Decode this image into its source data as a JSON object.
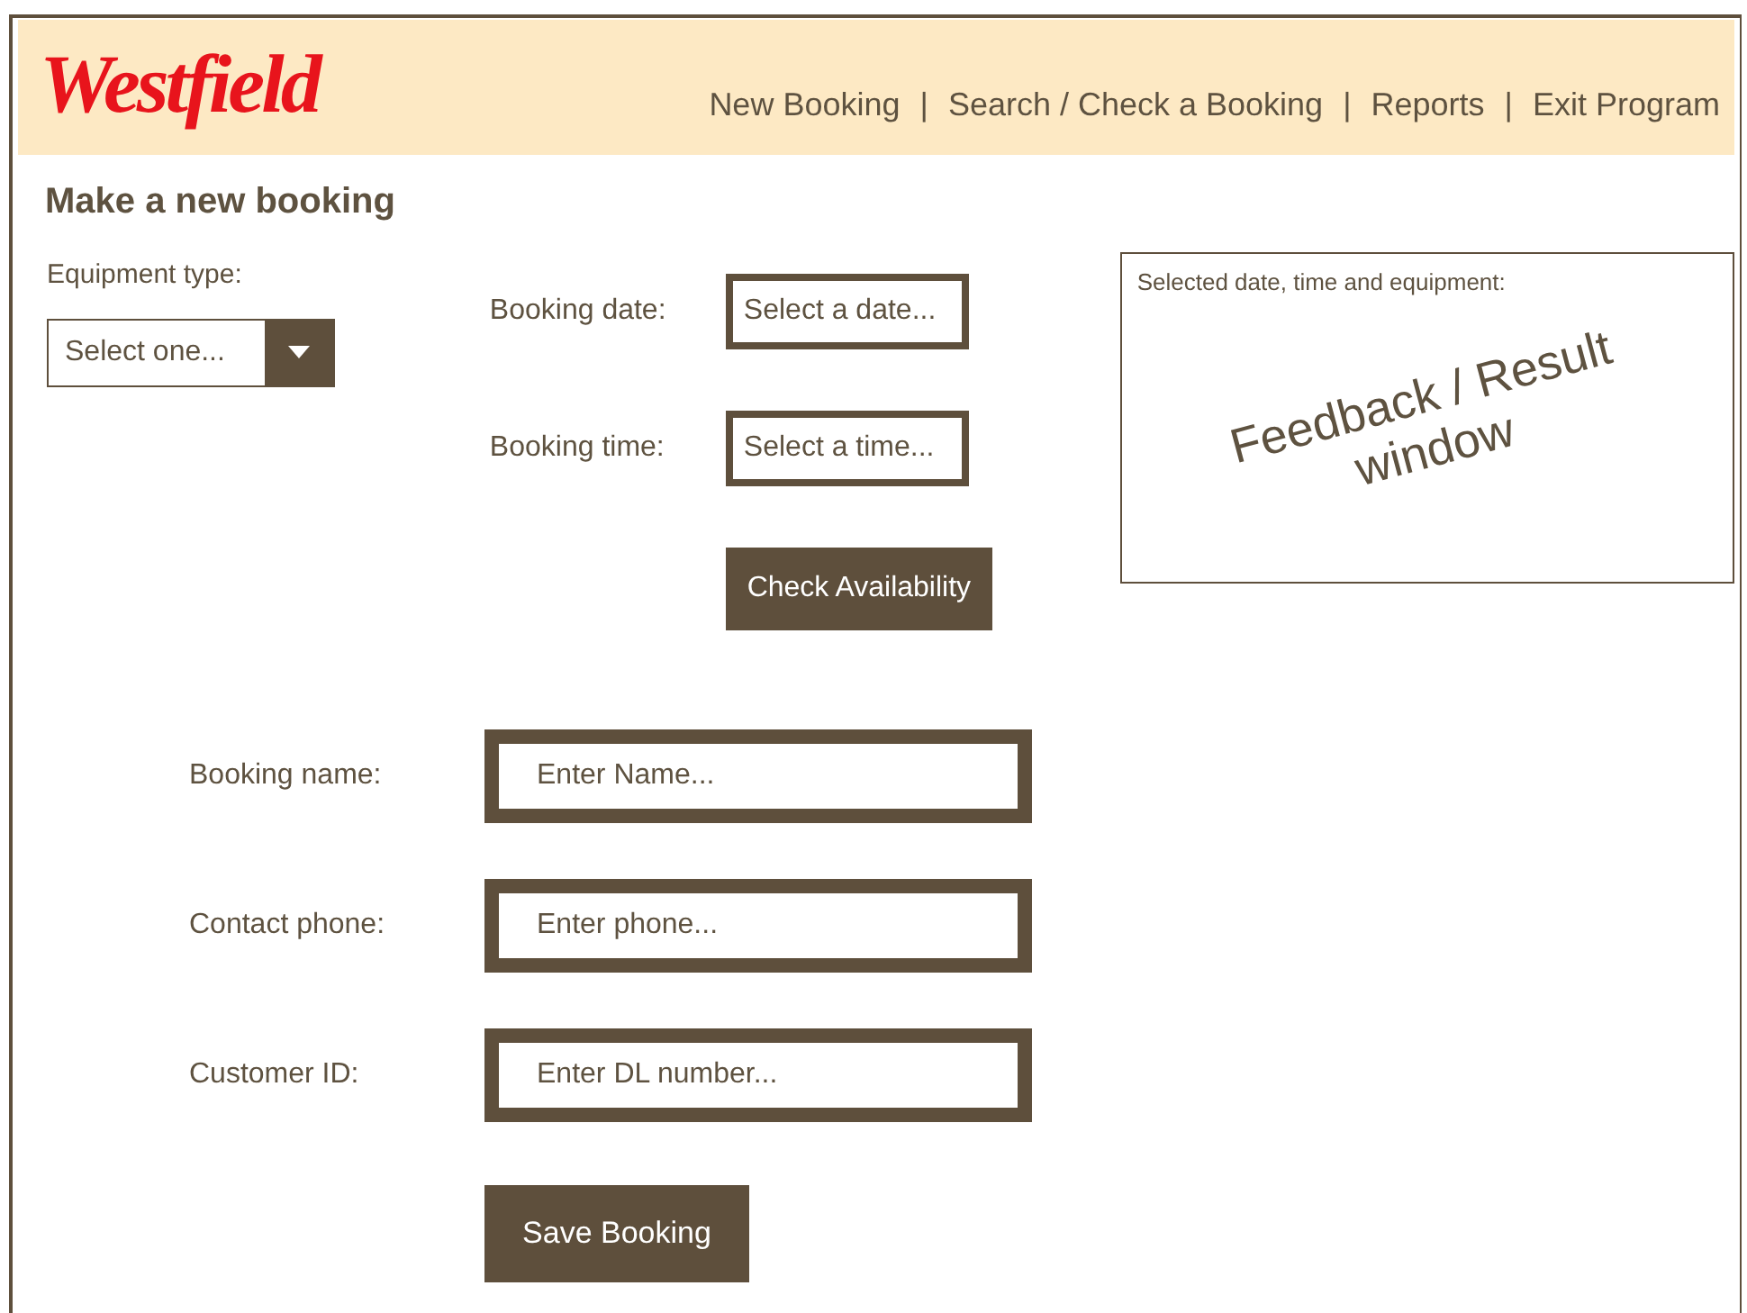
{
  "header": {
    "logo": "Westfield",
    "nav": [
      {
        "label": "New Booking"
      },
      {
        "label": "Search / Check a Booking"
      },
      {
        "label": "Reports"
      },
      {
        "label": "Exit Program"
      }
    ],
    "separator": "|"
  },
  "title": "Make a new booking",
  "equipment": {
    "label": "Equipment type:",
    "placeholder": "Select one..."
  },
  "date": {
    "label": "Booking date:",
    "placeholder": "Select a date..."
  },
  "time": {
    "label": "Booking time:",
    "placeholder": "Select a time..."
  },
  "check_button": "Check Availability",
  "feedback": {
    "heading": "Selected date, time and equipment:",
    "lines": [
      "Feedback / Result",
      "window"
    ]
  },
  "fields": [
    {
      "label": "Booking name:",
      "placeholder": "Enter Name..."
    },
    {
      "label": "Contact phone:",
      "placeholder": "Enter phone..."
    },
    {
      "label": "Customer ID:",
      "placeholder": "Enter DL number..."
    }
  ],
  "save_button": "Save Booking"
}
